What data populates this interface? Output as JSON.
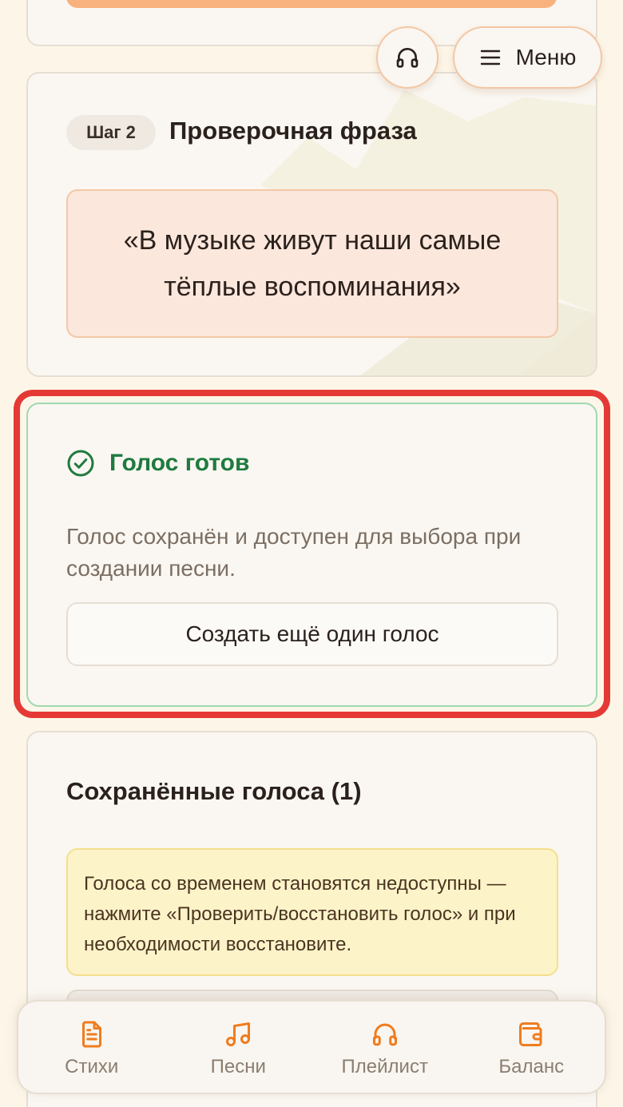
{
  "header": {
    "menu_label": "Меню",
    "headphones_icon": "headphones-icon",
    "menu_icon": "menu-icon"
  },
  "step2": {
    "pill": "Шаг 2",
    "title": "Проверочная фраза",
    "phrase": "«В музыке живут наши самые тёплые воспоминания»"
  },
  "ready": {
    "title": "Голос готов",
    "description": "Голос сохранён и доступен для выбора при создании песни.",
    "create_button": "Создать ещё один голос",
    "icon": "check-circle-icon"
  },
  "saved": {
    "title": "Сохранённые голоса (1)",
    "notice": "Голоса со временем становятся недоступны — нажмите «Проверить/восстановить голос» и при необходимости восстановите."
  },
  "nav": {
    "items": [
      {
        "label": "Стихи",
        "icon": "document-icon"
      },
      {
        "label": "Песни",
        "icon": "music-note-icon"
      },
      {
        "label": "Плейлист",
        "icon": "headphones-icon"
      },
      {
        "label": "Баланс",
        "icon": "wallet-icon"
      }
    ]
  },
  "colors": {
    "accent": "#f07c1e",
    "success": "#1f7a3e",
    "highlight": "#e53935",
    "background": "#fdf6e8"
  }
}
